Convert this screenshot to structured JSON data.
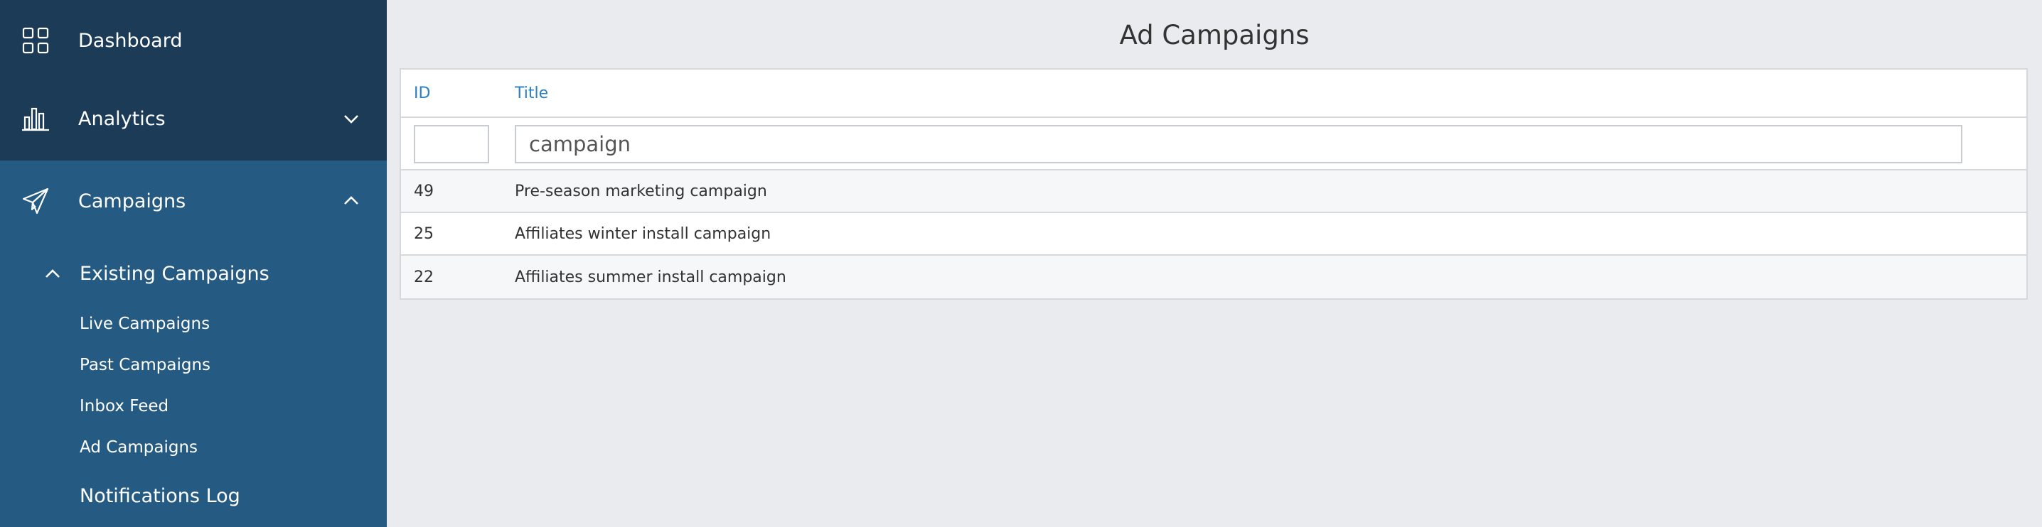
{
  "sidebar": {
    "dashboard": {
      "label": "Dashboard",
      "icon": "grid-icon"
    },
    "analytics": {
      "label": "Analytics",
      "icon": "bar-chart-icon"
    },
    "campaigns": {
      "label": "Campaigns",
      "icon": "paper-plane-icon"
    },
    "existing_campaigns": {
      "label": "Existing Campaigns"
    },
    "links": [
      "Live Campaigns",
      "Past Campaigns",
      "Inbox Feed",
      "Ad Campaigns"
    ],
    "notifications_log": {
      "label": "Notifications Log"
    },
    "colors": {
      "top_bg": "#1b3b57",
      "bg": "#255a82"
    }
  },
  "main": {
    "title": "Ad Campaigns",
    "table": {
      "headers": {
        "id": "ID",
        "title": "Title"
      },
      "filters": {
        "id_value": "",
        "title_value": "campaign"
      },
      "rows": [
        {
          "id": "49",
          "title": "Pre-season marketing campaign"
        },
        {
          "id": "25",
          "title": "Affiliates winter install campaign"
        },
        {
          "id": "22",
          "title": "Affiliates summer install campaign"
        }
      ]
    },
    "colors": {
      "link": "#2a7fc1",
      "bg": "#e9ebee"
    }
  }
}
